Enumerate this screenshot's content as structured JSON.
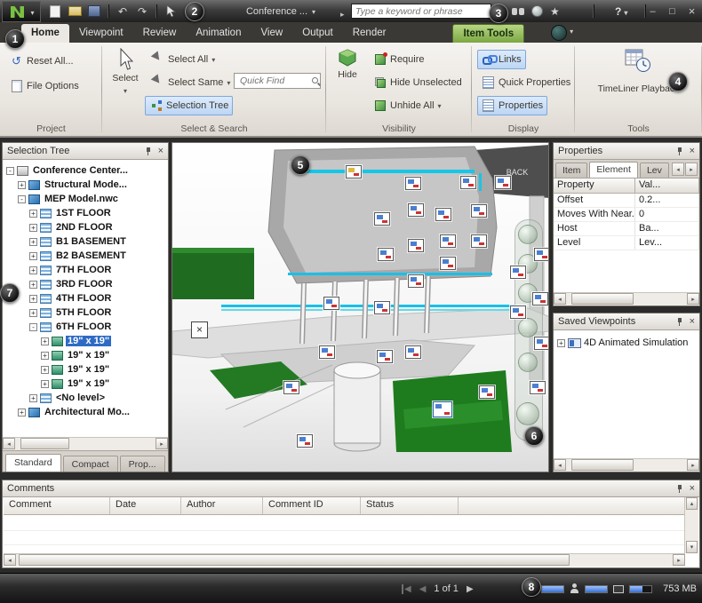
{
  "titlebar": {
    "doc_title": "Conference ...",
    "search_placeholder": "Type a keyword or phrase",
    "help_label": "?"
  },
  "icons": {
    "app_logo": "navisworks-n",
    "quick_access": [
      "new-file",
      "open",
      "save",
      "undo",
      "redo",
      "select-cursor"
    ],
    "infocenter": [
      "binoculars-search",
      "communication-center",
      "favorites-star",
      "help"
    ],
    "window_controls": [
      "minimize",
      "maximize",
      "close"
    ]
  },
  "ribbon_tabs": {
    "items": [
      "Home",
      "Viewpoint",
      "Review",
      "Animation",
      "View",
      "Output",
      "Render"
    ],
    "contextual": "Item Tools"
  },
  "ribbon": {
    "project": {
      "group_label": "Project",
      "reset_all": "Reset All...",
      "file_options": "File Options"
    },
    "select_search": {
      "group_label": "Select & Search",
      "select": "Select",
      "select_all": "Select All",
      "select_same": "Select Same",
      "quick_find_placeholder": "Quick Find",
      "selection_tree": "Selection Tree"
    },
    "visibility": {
      "group_label": "Visibility",
      "hide": "Hide",
      "require": "Require",
      "hide_unselected": "Hide Unselected",
      "unhide_all": "Unhide All"
    },
    "display": {
      "group_label": "Display",
      "links": "Links",
      "quick_properties": "Quick Properties",
      "properties": "Properties"
    },
    "tools": {
      "group_label": "Tools",
      "timeliner_playback": "TimeLiner Playback"
    }
  },
  "selection_tree": {
    "title": "Selection Tree",
    "items": [
      {
        "exp": "-",
        "label": "Conference Center..."
      },
      {
        "exp": "+",
        "label": "Structural Mode..."
      },
      {
        "exp": "-",
        "label": "MEP Model.nwc"
      },
      {
        "exp": "+",
        "label": "1ST FLOOR"
      },
      {
        "exp": "+",
        "label": "2ND FLOOR"
      },
      {
        "exp": "+",
        "label": "B1 BASEMENT"
      },
      {
        "exp": "+",
        "label": "B2 BASEMENT"
      },
      {
        "exp": "+",
        "label": "7TH FLOOR"
      },
      {
        "exp": "+",
        "label": "3RD FLOOR"
      },
      {
        "exp": "+",
        "label": "4TH FLOOR"
      },
      {
        "exp": "+",
        "label": "5TH FLOOR"
      },
      {
        "exp": "-",
        "label": "6TH FLOOR"
      },
      {
        "exp": "+",
        "label": "19\" x 19\""
      },
      {
        "exp": "+",
        "label": "19\" x 19\""
      },
      {
        "exp": "+",
        "label": "19\" x 19\""
      },
      {
        "exp": "+",
        "label": "19\" x 19\""
      },
      {
        "exp": "+",
        "label": "<No level>"
      },
      {
        "exp": "+",
        "label": "Architectural Mo..."
      }
    ],
    "tabs": [
      "Standard",
      "Compact",
      "Prop..."
    ]
  },
  "viewport": {
    "back_label": "BACK"
  },
  "properties": {
    "title": "Properties",
    "tabs": [
      "Item",
      "Element",
      "Lev"
    ],
    "columns": [
      "Property",
      "Val..."
    ],
    "rows": [
      {
        "name": "Offset",
        "value": "0.2..."
      },
      {
        "name": "Moves With Near...",
        "value": "0"
      },
      {
        "name": "Host",
        "value": "Ba..."
      },
      {
        "name": "Level",
        "value": "Lev..."
      }
    ]
  },
  "saved_viewpoints": {
    "title": "Saved Viewpoints",
    "items": [
      {
        "exp": "+",
        "label": "4D Animated Simulation"
      }
    ]
  },
  "comments": {
    "title": "Comments",
    "columns": [
      "Comment",
      "Date",
      "Author",
      "Comment ID",
      "Status"
    ]
  },
  "statusbar": {
    "page": "1 of 1",
    "memory": "753 MB"
  },
  "callouts": [
    "1",
    "2",
    "3",
    "4",
    "5",
    "6",
    "7",
    "8"
  ]
}
